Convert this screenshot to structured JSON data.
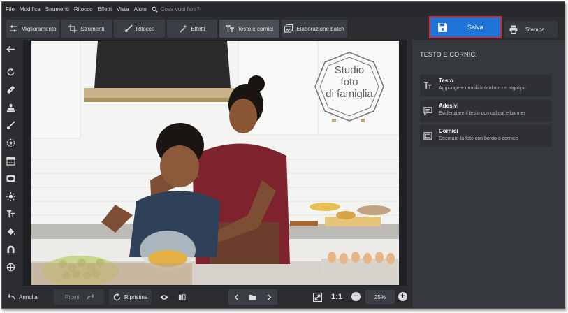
{
  "menu": [
    "File",
    "Modifica",
    "Strumenti",
    "Ritocco",
    "Effetti",
    "Vista",
    "Aiuto"
  ],
  "search_placeholder": "Cosa vuoi fare?",
  "tabs": [
    {
      "label": "Miglioramento",
      "icon": "sliders-icon"
    },
    {
      "label": "Strumenti",
      "icon": "crop-icon"
    },
    {
      "label": "Ritocco",
      "icon": "brush-icon"
    },
    {
      "label": "Effetti",
      "icon": "magic-wand-icon"
    },
    {
      "label": "Testo e cornici",
      "icon": "text-icon"
    },
    {
      "label": "Elaborazione batch",
      "icon": "images-icon"
    }
  ],
  "save_label": "Salva",
  "print_label": "Stampa",
  "panel": {
    "title": "TESTO E CORNICI",
    "items": [
      {
        "title": "Testo",
        "desc": "Aggiungere una didascalia o un logotipo",
        "icon": "text-icon"
      },
      {
        "title": "Adesivi",
        "desc": "Evidenziare il testo con callout e banner",
        "icon": "speech-bubble-icon"
      },
      {
        "title": "Cornici",
        "desc": "Decorare la foto con bordo o cornice",
        "icon": "frame-icon"
      }
    ]
  },
  "watermark": {
    "line1": "Studio",
    "line2": "foto",
    "line3": "di famiglia"
  },
  "bottom": {
    "undo_label": "Annulla",
    "redo_label": "Ripeti",
    "reset_label": "Ripristina",
    "ratio_label": "1:1",
    "zoom": "25%"
  },
  "colors": {
    "accent": "#1e73d6",
    "highlight": "#d6262e",
    "panel": "#35383d"
  }
}
